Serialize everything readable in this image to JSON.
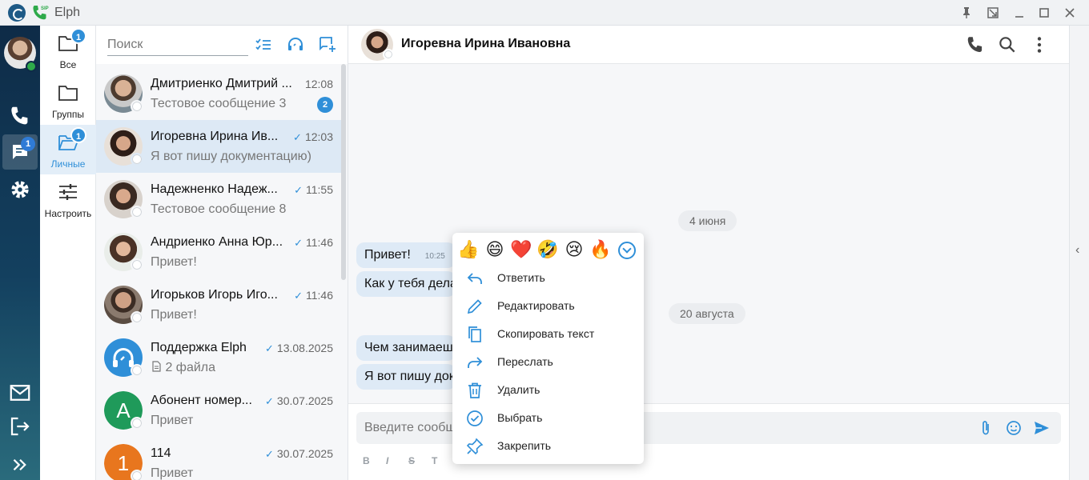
{
  "window": {
    "title": "Elph",
    "sip_label": "SIP"
  },
  "rail": {
    "chats_badge": "1"
  },
  "folders": [
    {
      "label": "Все",
      "badge": "1"
    },
    {
      "label": "Группы",
      "badge": ""
    },
    {
      "label": "Личные",
      "badge": "1"
    },
    {
      "label": "Настроить",
      "badge": ""
    }
  ],
  "search": {
    "placeholder": "Поиск"
  },
  "chats": [
    {
      "name": "Дмитриенко Дмитрий ...",
      "time": "12:08",
      "preview": "Тестовое сообщение 3",
      "unread": "2",
      "read": false
    },
    {
      "name": "Игоревна Ирина Ив...",
      "time": "12:03",
      "preview": "Я вот пишу документацию)",
      "unread": "",
      "read": true
    },
    {
      "name": "Надежненко Надеж...",
      "time": "11:55",
      "preview": "Тестовое сообщение 8",
      "unread": "",
      "read": true
    },
    {
      "name": "Андриенко Анна Юр...",
      "time": "11:46",
      "preview": "Привет!",
      "unread": "",
      "read": true
    },
    {
      "name": "Игорьков Игорь Иго...",
      "time": "11:46",
      "preview": "Привет!",
      "unread": "",
      "read": true
    },
    {
      "name": "Поддержка Elph",
      "time": "13.08.2025",
      "preview": "2 файла",
      "unread": "",
      "read": true
    },
    {
      "name": "Абонент номер...",
      "time": "30.07.2025",
      "preview": "Привет",
      "unread": "",
      "read": true,
      "letter": "A"
    },
    {
      "name": "114",
      "time": "30.07.2025",
      "preview": "Привет",
      "unread": "",
      "read": true,
      "letter": "1"
    }
  ],
  "conversation": {
    "title": "Игоревна Ирина Ивановна",
    "dates": [
      "4 июня",
      "20 августа"
    ],
    "messages": [
      {
        "text": "Привет!",
        "time": "10:25"
      },
      {
        "text": "Как у тебя дела"
      },
      {
        "text": "Чем занимаеш"
      },
      {
        "text": "Я вот пишу док"
      }
    ],
    "composer_placeholder": "Введите сообщ",
    "format_labels": [
      "B",
      "I",
      "S",
      "T"
    ]
  },
  "context_menu": {
    "reactions": [
      "👍",
      "😄",
      "❤️",
      "🤣",
      "😢",
      "🔥"
    ],
    "items": [
      {
        "label": "Ответить",
        "icon": "reply-icon"
      },
      {
        "label": "Редактировать",
        "icon": "pencil-icon"
      },
      {
        "label": "Скопировать текст",
        "icon": "copy-icon"
      },
      {
        "label": "Переслать",
        "icon": "forward-icon"
      },
      {
        "label": "Удалить",
        "icon": "trash-icon"
      },
      {
        "label": "Выбрать",
        "icon": "check-circle-icon"
      },
      {
        "label": "Закрепить",
        "icon": "pin-icon"
      }
    ]
  },
  "colors": {
    "accent": "#2f8fd8",
    "rail_dark": "#0e2b47",
    "bubble": "#deeaf6"
  }
}
